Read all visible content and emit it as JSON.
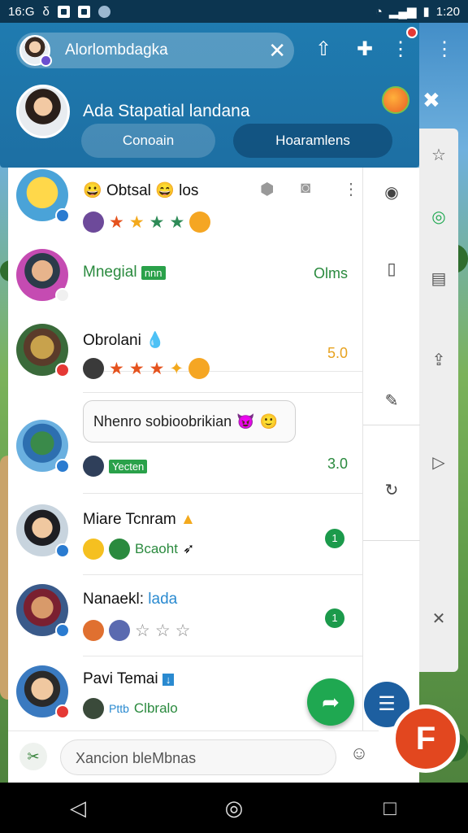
{
  "status_bar": {
    "time_left": "16:G",
    "glyph": "δ",
    "time_right": "1:20"
  },
  "header": {
    "search_text": "Alorlombdagka",
    "close_icon": "close-icon",
    "profile_name": "Ada Stapatial landana",
    "tabs": [
      "Conoain",
      "Hoaramlens"
    ]
  },
  "chats": [
    {
      "title": "Obtsal",
      "title_suffix": "los",
      "meta": "",
      "stars": [
        "★",
        "★",
        "★",
        "★"
      ],
      "star_colors": [
        "#e5531e",
        "#f3a91d",
        "#2e8b57",
        "#2e8b57"
      ]
    },
    {
      "title": "Mnegial",
      "tag": "nnn",
      "meta": "Olms",
      "meta_color": "#2a8a3e"
    },
    {
      "title": "Obrolani",
      "meta": "5.0",
      "meta_color": "#e7a21f",
      "stars": [
        "★",
        "★",
        "★",
        "✦"
      ],
      "star_colors": [
        "#e5531e",
        "#e5531e",
        "#e5531e",
        "#f3a91d"
      ]
    },
    {
      "bubble": "Nhenro sobioobrikian",
      "tag": "Yecten",
      "meta": "3.0",
      "meta_color": "#2a8a3e"
    },
    {
      "title": "Miare Tcnram",
      "sub_text": "Bcaoht",
      "dot": "1"
    },
    {
      "title": "Nanaekl:",
      "title_link": "lada",
      "dot": "1",
      "stars": [
        "☆",
        "☆",
        "☆"
      ],
      "star_colors": [
        "#888",
        "#888",
        "#888"
      ]
    },
    {
      "title": "Pavi Temai",
      "sub_link": "Pttb",
      "sub_text": "Clbralo"
    }
  ],
  "composer": {
    "placeholder": "Xancion bleMbnas"
  },
  "colors": {
    "header": "#1f7bb0",
    "accent_green": "#1fa851",
    "accent_red": "#e2471f",
    "accent_blue": "#1d5fa0"
  }
}
